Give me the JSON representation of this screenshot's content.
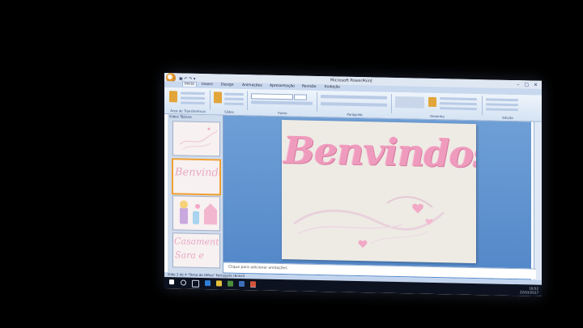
{
  "window": {
    "title": "Microsoft PowerPoint",
    "controls": "– ▢ ✕"
  },
  "quick_access": "▣ ↶ ↷ ▾",
  "ribbon_tabs": [
    "Início",
    "Inserir",
    "Design",
    "Animações",
    "Apresentação",
    "Revisão",
    "Exibição"
  ],
  "ribbon_groups": [
    "Área de Transferência",
    "Slides",
    "Fonte",
    "Parágrafo",
    "Desenho",
    "Edição"
  ],
  "left_pane": {
    "tabs_label": "Slides  Tópicos",
    "thumbnails": [
      {
        "text": ""
      },
      {
        "text": "Benvindos"
      },
      {
        "text": ""
      },
      {
        "text": "Casamento",
        "text2": "Sara e"
      }
    ]
  },
  "slide": {
    "title": "Benvindos"
  },
  "notes": {
    "placeholder": "Clique para adicionar anotações"
  },
  "status_bar": {
    "left": "Slide 2 de 4   \"Tema do Office\"   Português (Brasil)"
  },
  "taskbar": {
    "time": "18:52",
    "date": "22/03/2017"
  },
  "colors": {
    "slide_title": "#ef9bbd",
    "editor_bg": "#5a8fcf",
    "selected_thumb": "#f0a030"
  }
}
